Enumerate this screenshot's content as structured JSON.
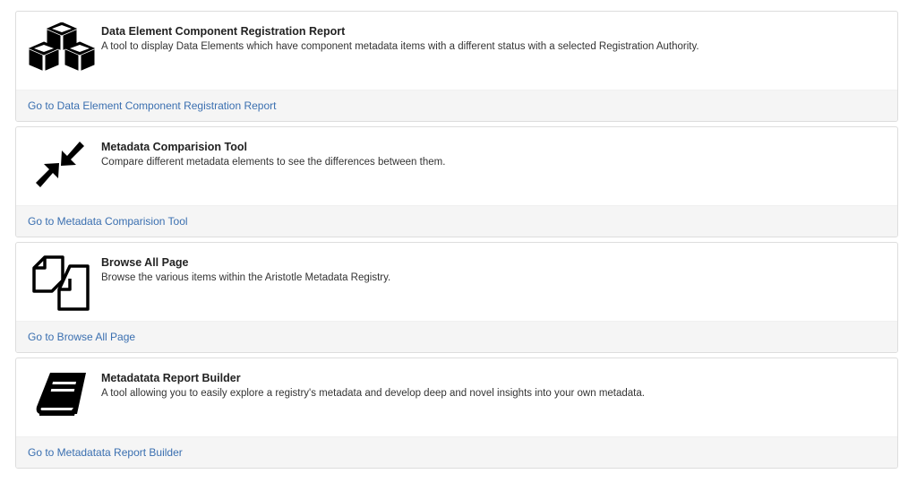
{
  "tools": [
    {
      "title": "Data Element Component Registration Report",
      "description": "A tool to display Data Elements which have component metadata items with a different status with a selected Registration Authority.",
      "link_label": "Go to Data Element Component Registration Report",
      "icon": "cubes-icon"
    },
    {
      "title": "Metadata Comparision Tool",
      "description": "Compare different metadata elements to see the differences between them.",
      "link_label": "Go to Metadata Comparision Tool",
      "icon": "compress-arrows-icon"
    },
    {
      "title": "Browse All Page",
      "description": "Browse the various items within the Aristotle Metadata Registry.",
      "link_label": "Go to Browse All Page",
      "icon": "copy-files-icon"
    },
    {
      "title": "Metadatata Report Builder",
      "description": "A tool allowing you to easily explore a registry's metadata and develop deep and novel insights into your own metadata.",
      "link_label": "Go to Metadatata Report Builder",
      "icon": "book-icon"
    }
  ],
  "colors": {
    "link": "#3a6fb0",
    "footer_bg": "#f5f5f5",
    "border": "#dddddd"
  }
}
